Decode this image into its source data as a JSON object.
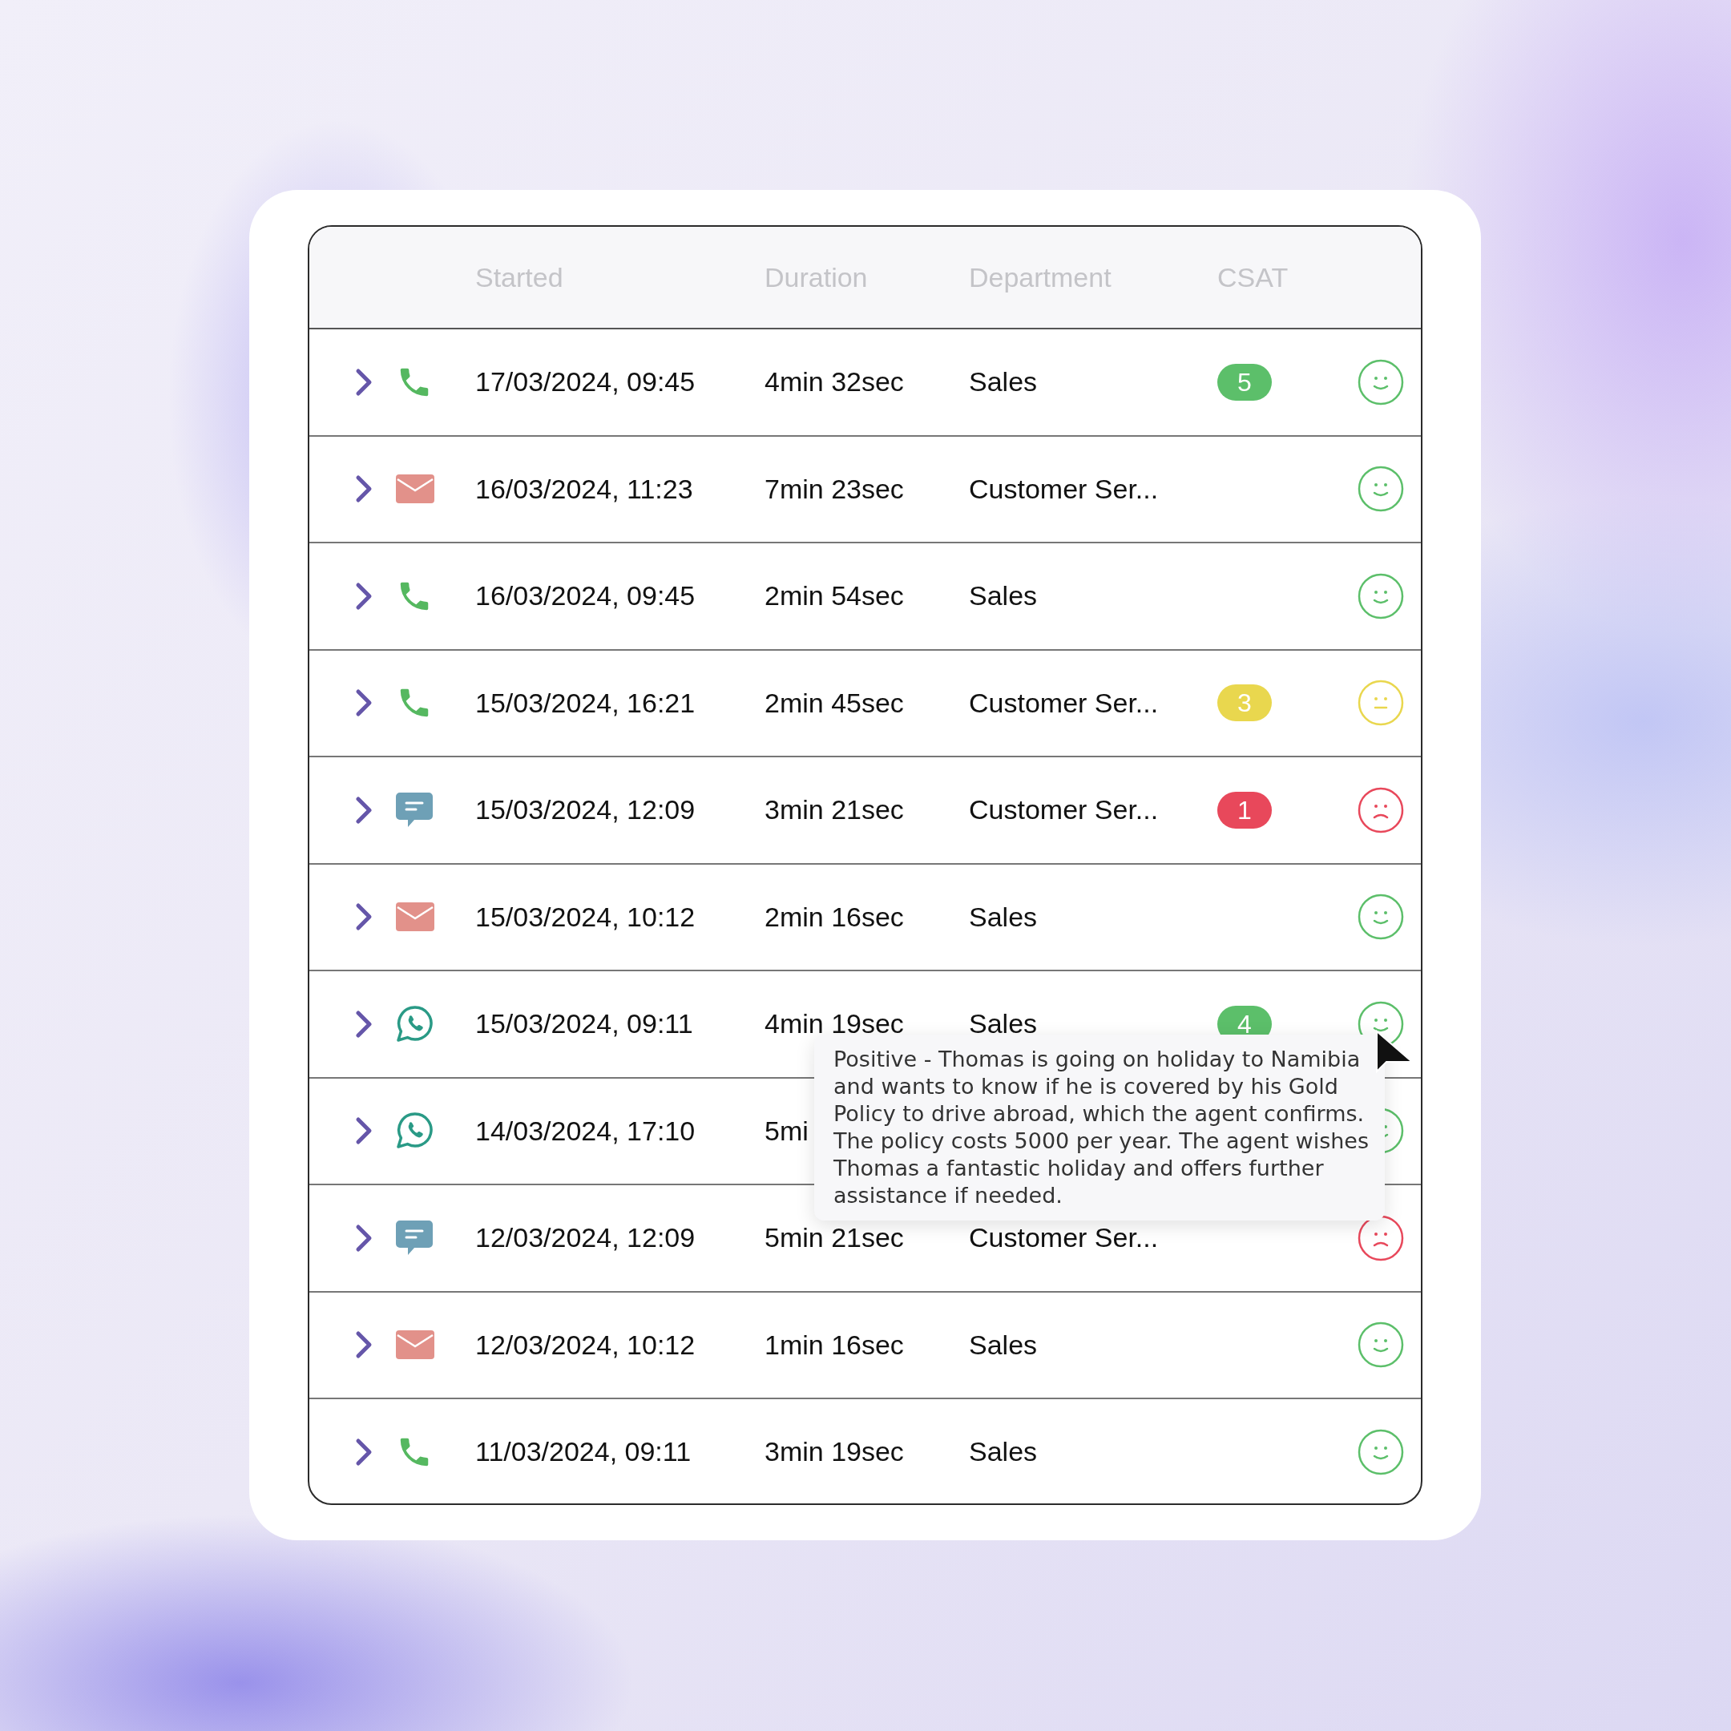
{
  "table": {
    "columns": [
      "Started",
      "Duration",
      "Department",
      "CSAT"
    ],
    "rows": [
      {
        "channel": {
          "kind": "phone"
        },
        "started": "17/03/2024, 09:45",
        "duration": "4min 32sec",
        "department": "Sales",
        "csat": "5",
        "face": {
          "kind": "smile",
          "color": "#5cbf6a"
        }
      },
      {
        "channel": {
          "kind": "email"
        },
        "started": "16/03/2024, 11:23",
        "duration": "7min 23sec",
        "department": "Customer Ser...",
        "face": {
          "kind": "smile",
          "color": "#5cbf6a"
        }
      },
      {
        "channel": {
          "kind": "phone"
        },
        "started": "16/03/2024, 09:45",
        "duration": "2min 54sec",
        "department": "Sales",
        "face": {
          "kind": "smile",
          "color": "#5cbf6a"
        }
      },
      {
        "channel": {
          "kind": "phone"
        },
        "started": "15/03/2024, 16:21",
        "duration": "2min 45sec",
        "department": "Customer Ser...",
        "csat": "3",
        "face": {
          "kind": "neutral",
          "color": "#e9d74e"
        }
      },
      {
        "channel": {
          "kind": "chat"
        },
        "started": "15/03/2024, 12:09",
        "duration": "3min 21sec",
        "department": "Customer Ser...",
        "csat": "1",
        "face": {
          "kind": "frown",
          "color": "#e8485b"
        }
      },
      {
        "channel": {
          "kind": "email"
        },
        "started": "15/03/2024, 10:12",
        "duration": "2min 16sec",
        "department": "Sales",
        "face": {
          "kind": "smile",
          "color": "#5cbf6a"
        }
      },
      {
        "channel": {
          "kind": "whatsapp"
        },
        "started": "15/03/2024, 09:11",
        "duration": "4min 19sec",
        "department": "Sales",
        "csat": "4",
        "face": {
          "kind": "smile",
          "color": "#5cbf6a"
        }
      },
      {
        "channel": {
          "kind": "whatsapp"
        },
        "started": "14/03/2024, 17:10",
        "duration": "5mi",
        "face": {
          "kind": "smile",
          "color": "#5cbf6a"
        }
      },
      {
        "channel": {
          "kind": "chat"
        },
        "started": "12/03/2024, 12:09",
        "duration": "5min 21sec",
        "department": "Customer Ser...",
        "face": {
          "kind": "frown",
          "color": "#e8485b"
        }
      },
      {
        "channel": {
          "kind": "email"
        },
        "started": "12/03/2024, 10:12",
        "duration": "1min 16sec",
        "department": "Sales",
        "face": {
          "kind": "smile",
          "color": "#5cbf6a"
        }
      },
      {
        "channel": {
          "kind": "phone"
        },
        "started": "11/03/2024, 09:11",
        "duration": "3min 19sec",
        "department": "Sales",
        "face": {
          "kind": "smile",
          "color": "#5cbf6a"
        }
      }
    ]
  },
  "tooltip": {
    "text": "Positive - Thomas is going on holiday to Namibia and wants to know if he is covered by his Gold Policy to drive abroad, which the agent confirms. The policy costs 5000 per year. The agent wishes Thomas a fantastic holiday and offers further assistance if needed."
  }
}
